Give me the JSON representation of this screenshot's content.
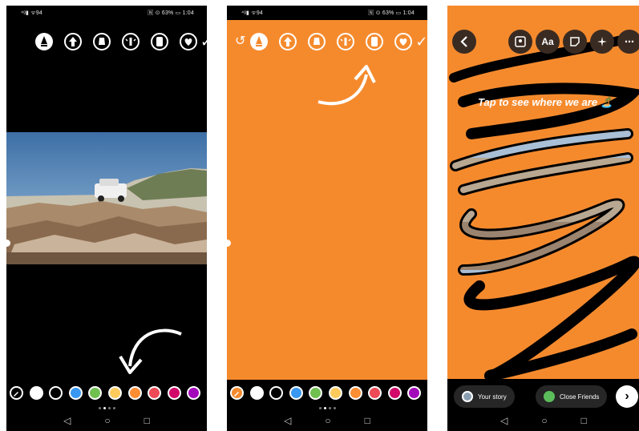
{
  "screens": [
    {
      "status": {
        "left": "⁴ᵍ▮ ᯤ94",
        "right": "🄽 ⊙ 63% ▭ 1:04"
      },
      "toolbar_icons": [
        "pen-marker-icon",
        "arrow-up-icon",
        "marker-icon",
        "neon-brush-icon",
        "eraser-icon",
        "heart-brush-icon"
      ],
      "confirm": "✓"
    },
    {
      "status": {
        "left": "⁴ᵍ▮ ᯤ94",
        "right": "🄽 ⊙ 63% ▭ 1:04"
      },
      "undo": "↺",
      "confirm": "✓"
    },
    {
      "caption": "Tap to see where we are 🏝️",
      "top_buttons": [
        "Aa",
        "⋯"
      ],
      "your_story": "Your story",
      "close_friends": "Close Friends",
      "send": "›"
    }
  ],
  "palette": [
    "#ffffff",
    "#000000",
    "#3897f0",
    "#70c050",
    "#fdcb5c",
    "#fd8d32",
    "#ed4956",
    "#d10869",
    "#a307ba"
  ],
  "nav": {
    "back": "◁",
    "home": "○",
    "recent": "□"
  }
}
